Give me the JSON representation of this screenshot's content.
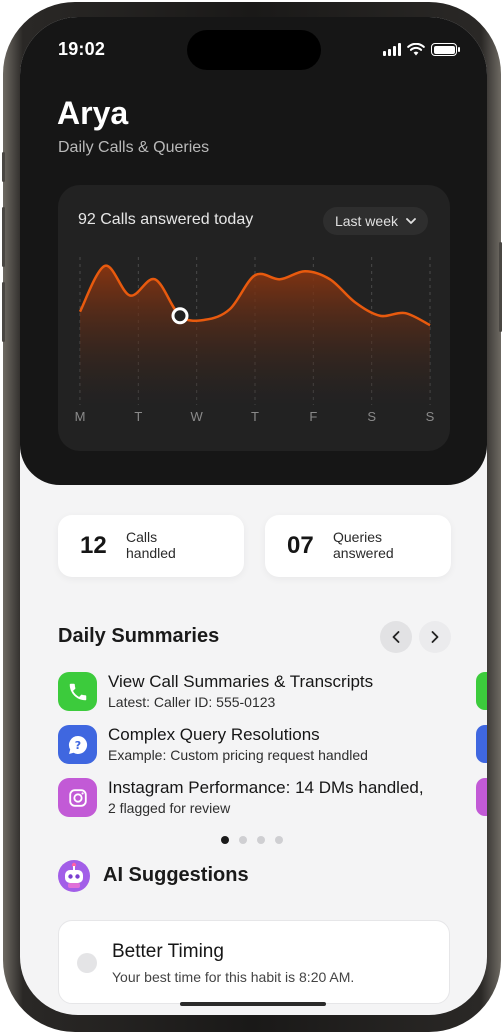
{
  "status_bar": {
    "time": "19:02"
  },
  "header": {
    "title": "Arya",
    "subtitle": "Daily Calls & Queries"
  },
  "chart_card": {
    "heading": "92 Calls answered today",
    "range_select": "Last week"
  },
  "chart_data": {
    "type": "area",
    "categories": [
      "M",
      "T",
      "W",
      "T",
      "F",
      "S",
      "S"
    ],
    "series": [
      {
        "values": [
          0.58,
          0.92,
          0.7,
          0.82,
          0.55,
          0.52,
          0.6,
          0.85,
          0.82,
          0.88,
          0.82,
          0.65,
          0.55,
          0.57,
          0.48
        ]
      }
    ],
    "ylim": [
      0,
      1
    ],
    "highlight_index": 4,
    "grid": true,
    "colors": {
      "line": "#e85a0e",
      "fill_top": "#8a3510",
      "fill_bottom": "#222222",
      "marker": "#ffffff"
    }
  },
  "stats": [
    {
      "value": "12",
      "label_line1": "Calls",
      "label_line2": "handled"
    },
    {
      "value": "07",
      "label_line1": "Queries",
      "label_line2": "answered"
    }
  ],
  "daily_summaries": {
    "title": "Daily Summaries",
    "items": [
      {
        "icon": "phone-icon",
        "color": "#3ccb3c",
        "title": "View Call Summaries & Transcripts",
        "subtitle": "Latest: Caller ID: 555-0123"
      },
      {
        "icon": "question-icon",
        "color": "#3f67e0",
        "title": "Complex Query Resolutions",
        "subtitle": "Example: Custom pricing request handled"
      },
      {
        "icon": "instagram-icon",
        "color": "#c25ad6",
        "title": "Instagram Performance: 14 DMs handled,",
        "subtitle": "2 flagged for review"
      }
    ],
    "page_count": 4,
    "current_page": 1
  },
  "ai_suggestions": {
    "title": "AI Suggestions"
  },
  "suggestion": {
    "title": "Better Timing",
    "text": "Your best time for this habit is 8:20 AM."
  }
}
